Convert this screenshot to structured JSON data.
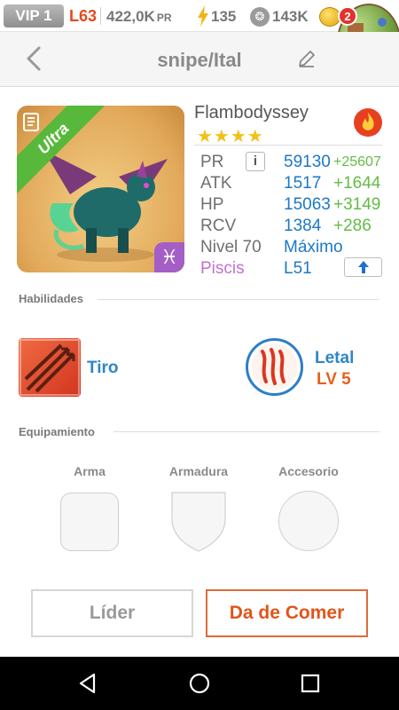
{
  "status_bar": {
    "vip": "VIP 1",
    "level": "L63",
    "power": "422,0K",
    "power_unit": "PR",
    "energy": "135",
    "food": "143K",
    "notifications": "2"
  },
  "header": {
    "title": "snipe/Ital"
  },
  "creature": {
    "rarity": "Ultra",
    "name": "Flambodyssey",
    "stars": "★★★★",
    "stats": [
      {
        "label": "PR",
        "value": "59130",
        "bonus": "+25607"
      },
      {
        "label": "ATK",
        "value": "1517",
        "bonus": "+1644"
      },
      {
        "label": "HP",
        "value": "15063",
        "bonus": "+3149"
      },
      {
        "label": "RCV",
        "value": "1384",
        "bonus": "+286"
      }
    ],
    "level_label": "Nivel 70",
    "level_value": "Máximo",
    "zodiac_label": "Piscis",
    "zodiac_level": "L51",
    "zodiac_symbol": "♓"
  },
  "skills": {
    "section_title": "Habilidades",
    "skill1_name": "Tiro",
    "skill2_name": "Letal",
    "skill2_level": "LV 5"
  },
  "equipment": {
    "section_title": "Equipamiento",
    "weapon": "Arma",
    "armor": "Armadura",
    "accessory": "Accesorio"
  },
  "actions": {
    "leader": "Líder",
    "feed": "Da de Comer"
  },
  "colors": {
    "accent_blue": "#1b78c8",
    "bonus_green": "#63bc46",
    "feed_orange": "#e0551a",
    "rarity_green": "#57b83b"
  }
}
